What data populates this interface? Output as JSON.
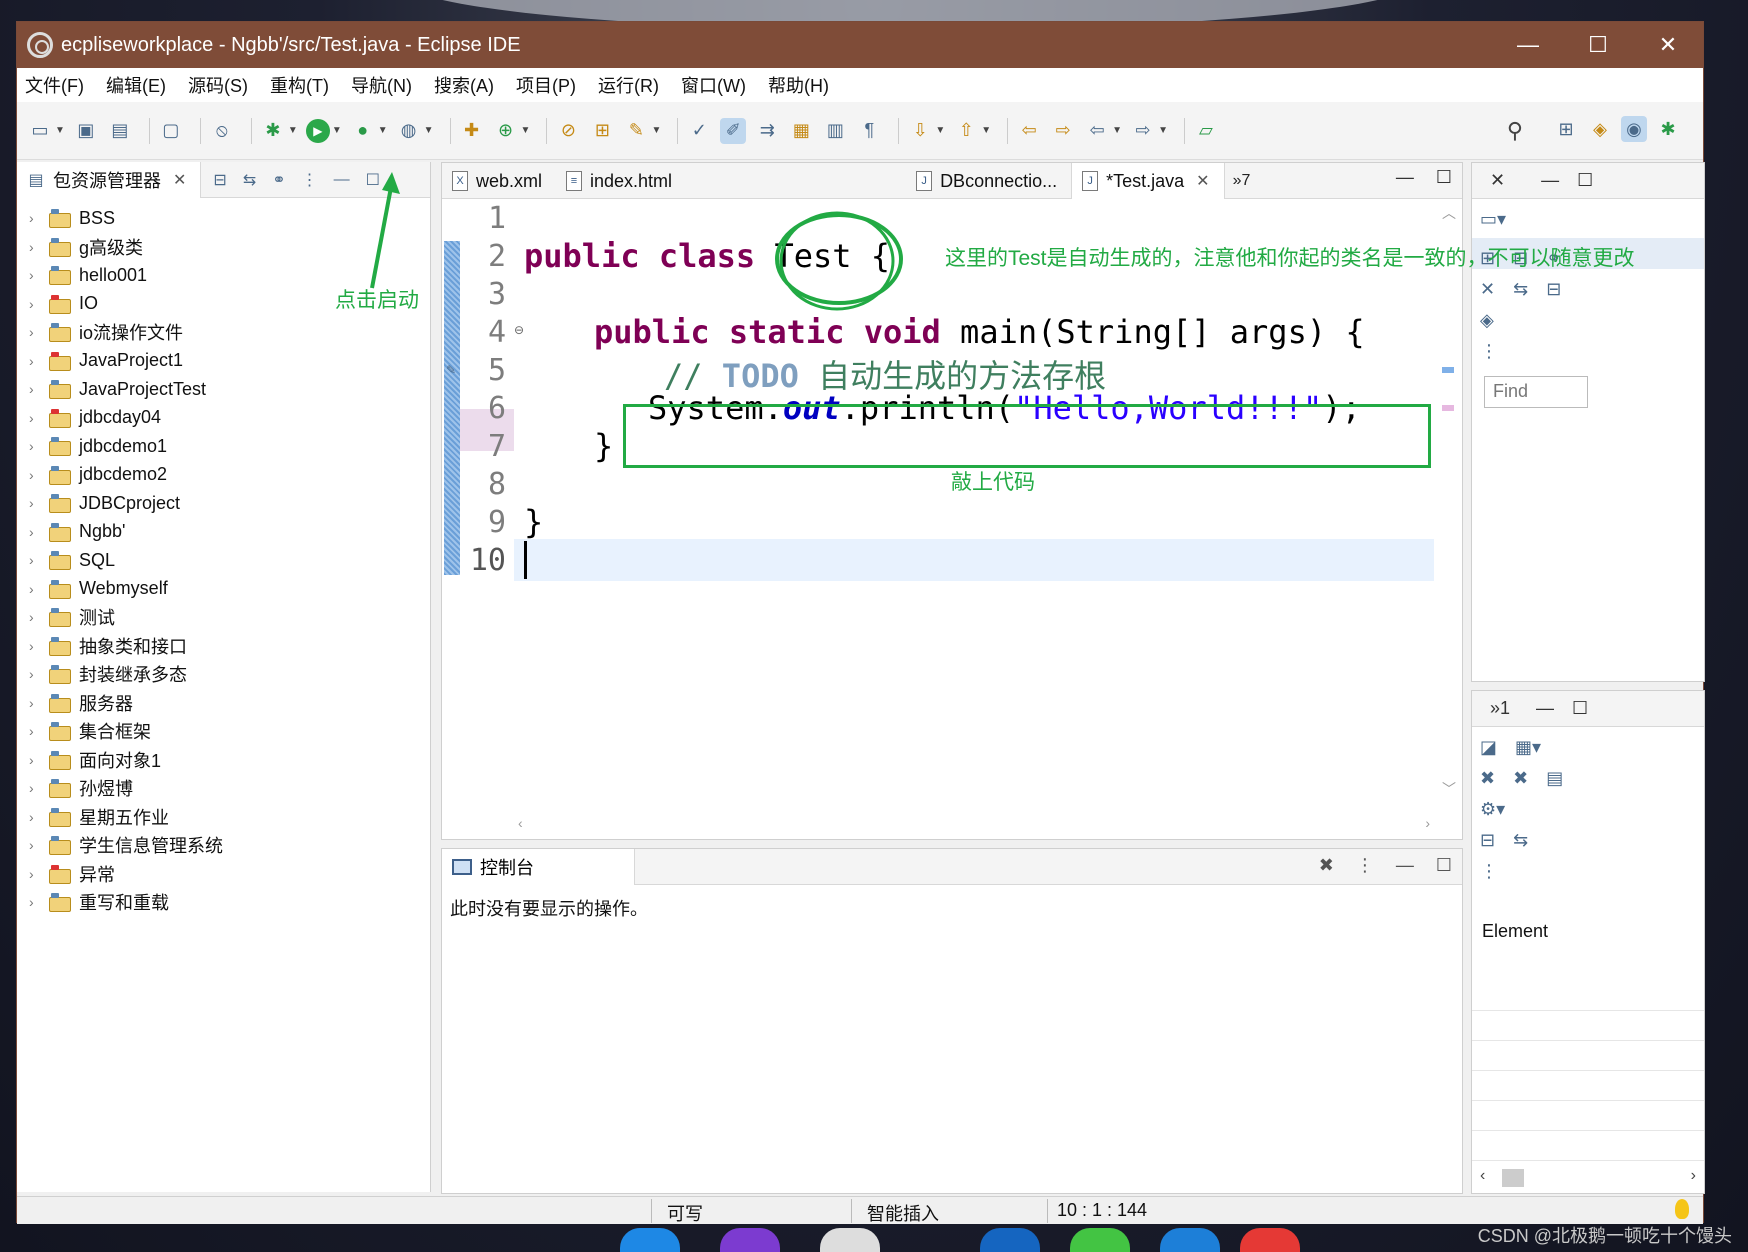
{
  "window": {
    "title": "ecpliseworkplace - Ngbb'/src/Test.java - Eclipse IDE"
  },
  "menu": [
    "文件(F)",
    "编辑(E)",
    "源码(S)",
    "重构(T)",
    "导航(N)",
    "搜索(A)",
    "项目(P)",
    "运行(R)",
    "窗口(W)",
    "帮助(H)"
  ],
  "explorer": {
    "title": "包资源管理器",
    "projects": [
      {
        "name": "BSS",
        "error": false
      },
      {
        "name": "g高级类",
        "error": false
      },
      {
        "name": "hello001",
        "error": false
      },
      {
        "name": "IO",
        "error": true
      },
      {
        "name": "io流操作文件",
        "error": false
      },
      {
        "name": "JavaProject1",
        "error": true
      },
      {
        "name": "JavaProjectTest",
        "error": false
      },
      {
        "name": "jdbcday04",
        "error": true
      },
      {
        "name": "jdbcdemo1",
        "error": false
      },
      {
        "name": "jdbcdemo2",
        "error": false
      },
      {
        "name": "JDBCproject",
        "error": false
      },
      {
        "name": "Ngbb'",
        "error": false
      },
      {
        "name": "SQL",
        "error": false
      },
      {
        "name": "Webmyself",
        "error": false
      },
      {
        "name": "测试",
        "error": false
      },
      {
        "name": "抽象类和接口",
        "error": false
      },
      {
        "name": "封装继承多态",
        "error": false
      },
      {
        "name": "服务器",
        "error": false
      },
      {
        "name": "集合框架",
        "error": false
      },
      {
        "name": "面向对象1",
        "error": false
      },
      {
        "name": "孙煜博",
        "error": false
      },
      {
        "name": "星期五作业",
        "error": false
      },
      {
        "name": "学生信息管理系统",
        "error": false
      },
      {
        "name": "异常",
        "error": true
      },
      {
        "name": "重写和重载",
        "error": false
      }
    ]
  },
  "editor": {
    "tabs": [
      "web.xml",
      "index.html",
      "DBconnectio...",
      "*Test.java"
    ],
    "tab_overflow": "»7",
    "line_numbers": [
      "1",
      "2",
      "3",
      "4",
      "5",
      "6",
      "7",
      "8",
      "9",
      "10"
    ],
    "code": {
      "kw_public": "public",
      "kw_class": "class",
      "class_name": "Test",
      "brace_open": "{",
      "kw_static": "static",
      "kw_void": "void",
      "main_sig": "main(String[] args) {",
      "comment_slashes": "//",
      "comment_todo": "TODO",
      "comment_text": "自动生成的方法存根",
      "sys_prefix": "System.",
      "sys_out": "out",
      "sys_println": ".println(",
      "string_literal": "\"Hello,World!!!\"",
      "sys_suffix": ");",
      "brace_close": "}"
    }
  },
  "console": {
    "title": "控制台",
    "message": "此时没有要显示的操作。"
  },
  "right_panel": {
    "find_placeholder": "Find",
    "overflow": "»1",
    "element_label": "Element"
  },
  "status": {
    "writable": "可写",
    "insert_mode": "智能插入",
    "position": "10 : 1 : 144"
  },
  "annotations": {
    "start": "点击启动",
    "note": "这里的Test是自动生成的，注意他和你起的类名是一致的，不可以随意更改",
    "type_code": "敲上代码"
  },
  "watermark": "CSDN @北极鹅一顿吃十个馒头",
  "colors": {
    "titlebar": "#7f4c38",
    "annotation": "#22aa44",
    "keyword": "#7f0055",
    "string": "#2a00ff"
  }
}
